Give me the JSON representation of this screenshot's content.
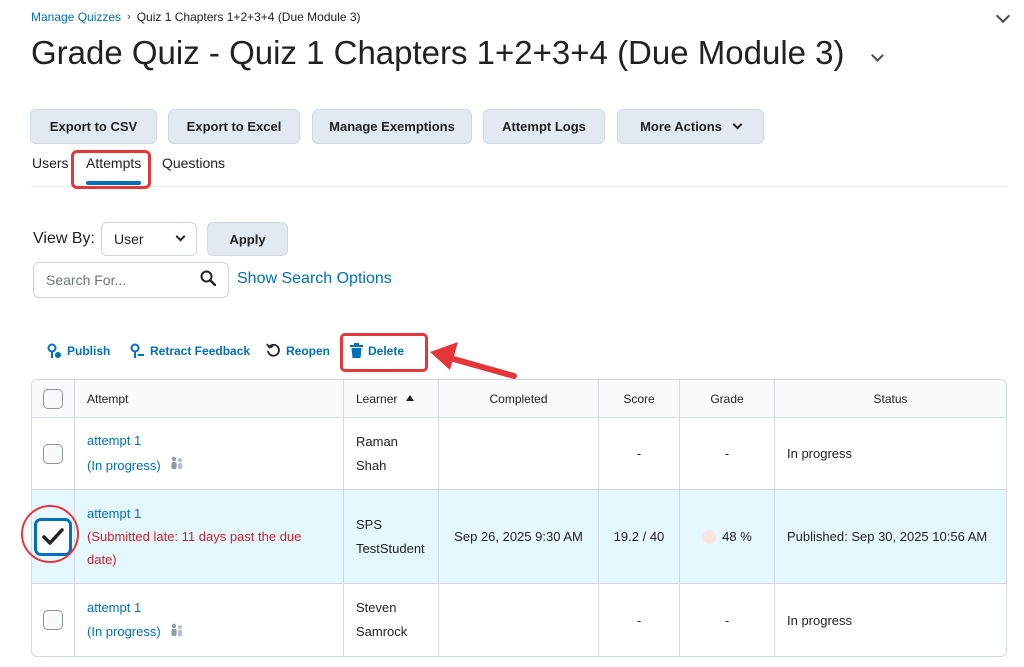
{
  "breadcrumb": {
    "link": "Manage Quizzes",
    "separator": "›",
    "current": "Quiz 1 Chapters 1+2+3+4 (Due Module 3)"
  },
  "page_title": "Grade Quiz - Quiz 1 Chapters 1+2+3+4 (Due Module 3)",
  "toolbar": {
    "export_csv": "Export to CSV",
    "export_excel": "Export to Excel",
    "manage_exemptions": "Manage Exemptions",
    "attempt_logs": "Attempt Logs",
    "more_actions": "More Actions"
  },
  "tabs": [
    "Users",
    "Attempts",
    "Questions"
  ],
  "active_tab": "Attempts",
  "filter": {
    "view_by_label": "View By:",
    "view_by_value": "User",
    "apply": "Apply"
  },
  "search": {
    "placeholder": "Search For...",
    "show_options": "Show Search Options"
  },
  "actions": {
    "publish": "Publish",
    "retract": "Retract Feedback",
    "reopen": "Reopen",
    "delete": "Delete"
  },
  "table": {
    "headers": {
      "attempt": "Attempt",
      "learner": "Learner",
      "completed": "Completed",
      "score": "Score",
      "grade": "Grade",
      "status": "Status"
    },
    "rows": [
      {
        "attempt": "attempt 1",
        "state": "(In progress)",
        "learner_first": "Raman",
        "learner_last": "Shah",
        "completed": "",
        "score": "-",
        "grade": "-",
        "status": "In progress",
        "selected": false
      },
      {
        "attempt": "attempt 1",
        "state": "(Submitted late: 11 days past the due date)",
        "learner_first": "SPS",
        "learner_last": "TestStudent",
        "completed": "Sep 26, 2025 9:30 AM",
        "score": "19.2 / 40",
        "grade": "48 %",
        "status": "Published: Sep 30, 2025 10:56 AM",
        "selected": true
      },
      {
        "attempt": "attempt 1",
        "state": "(In progress)",
        "learner_first": "Steven",
        "learner_last": "Samrock",
        "completed": "",
        "score": "-",
        "grade": "-",
        "status": "In progress",
        "selected": false
      }
    ]
  },
  "colors": {
    "link": "#006fbf",
    "highlight": "#e5373a",
    "late": "#cd2026",
    "selected_row": "#e6f8ff"
  }
}
